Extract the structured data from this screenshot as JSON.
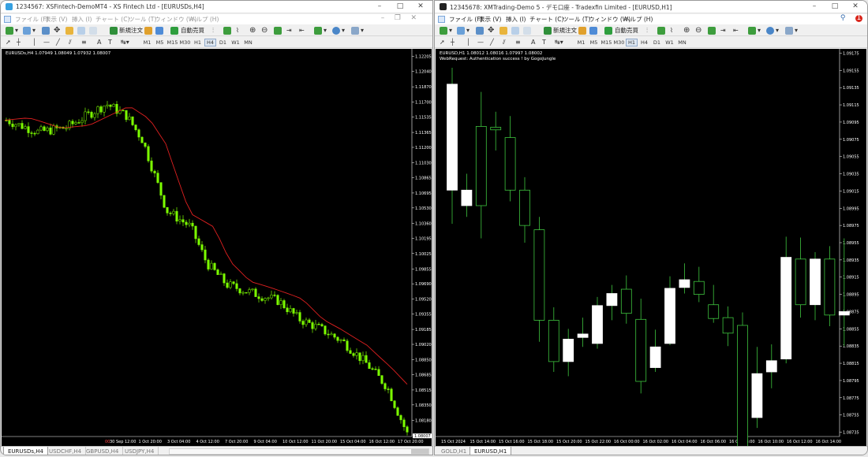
{
  "left": {
    "title": "1234567: XSFintech-DemoMT4 - XS Fintech Ltd - [EURUSDs,H4]",
    "menu": [
      "ファイル (F)",
      "表示 (V)",
      "挿入 (I)",
      "チャート (C)",
      "ツール (T)",
      "ウィンドウ (W)",
      "ヘルプ (H)"
    ],
    "toolbar": {
      "new_order": "新規注文",
      "auto_trade": "自動売買",
      "text_tool": "A"
    },
    "timeframes": [
      "M1",
      "M5",
      "M15",
      "M30",
      "H1",
      "H4",
      "D1",
      "W1",
      "MN"
    ],
    "selected_timeframe": "H4",
    "symbol_info": "EURUSDs,H4  1.07949 1.08049 1.07932 1.08007",
    "price_labels": [
      "1.12205",
      "1.12040",
      "1.11870",
      "1.11700",
      "1.11535",
      "1.11365",
      "1.11200",
      "1.11030",
      "1.10865",
      "1.10695",
      "1.10530",
      "1.10360",
      "1.10195",
      "1.10025",
      "1.09855",
      "1.09690",
      "1.09520",
      "1.09355",
      "1.09185",
      "1.09020",
      "1.08850",
      "1.08685",
      "1.08515",
      "1.08350",
      "1.08180"
    ],
    "current_price": "1.08007",
    "time_labels": [
      "00",
      "30 Sep 12:00",
      "1 Oct 20:00",
      "3 Oct 04:00",
      "4 Oct 12:00",
      "7 Oct 20:00",
      "9 Oct 04:00",
      "10 Oct 12:00",
      "11 Oct 20:00",
      "15 Oct 04:00",
      "16 Oct 12:00",
      "17 Oct 20:00"
    ],
    "tabs": [
      "EURUSDs,H4",
      "USDCHF,H4",
      "GBPUSD,H4",
      "USDJPY,H4"
    ],
    "active_tab": "EURUSDs,H4",
    "colors": {
      "candle": "#7CFC00",
      "ma": "#e02020"
    }
  },
  "right": {
    "title": "12345678: XMTrading-Demo 5 - デモ口座 - Tradexfin Limited - [EURUSD,H1]",
    "menu": [
      "ファイル (F)",
      "表示 (V)",
      "挿入 (I)",
      "チャート (C)",
      "ツール (T)",
      "ウィンドウ (W)",
      "ヘルプ (H)"
    ],
    "toolbar": {
      "new_order": "新規注文",
      "auto_trade": "自動売買",
      "text_tool": "A"
    },
    "timeframes": [
      "M1",
      "M5",
      "M15",
      "M30",
      "H1",
      "H4",
      "D1",
      "W1",
      "MN"
    ],
    "selected_timeframe": "H1",
    "symbol_info": "EURUSD,H1  1.08012 1.08016 1.07997 1.08002",
    "sub_info": "WebRequest: Authentication success ! by GogoJungle",
    "price_labels": [
      "1.09175",
      "1.09155",
      "1.09135",
      "1.09115",
      "1.09095",
      "1.09075",
      "1.09055",
      "1.09035",
      "1.09015",
      "1.08995",
      "1.08975",
      "1.08955",
      "1.08935",
      "1.08915",
      "1.08895",
      "1.08875",
      "1.08855",
      "1.08835",
      "1.08815",
      "1.08795",
      "1.08775",
      "1.08755",
      "1.08735"
    ],
    "time_labels": [
      "15 Oct 2024",
      "15 Oct 14:00",
      "15 Oct 16:00",
      "15 Oct 18:00",
      "15 Oct 20:00",
      "15 Oct 22:00",
      "16 Oct 00:00",
      "16 Oct 02:00",
      "16 Oct 04:00",
      "16 Oct 06:00",
      "16 Oct 08:00",
      "16 Oct 10:00",
      "16 Oct 12:00",
      "16 Oct 14:00"
    ],
    "tabs": [
      "GOLD,H1",
      "EURUSD,H1"
    ],
    "active_tab": "EURUSD,H1",
    "colors": {
      "bull_body": "#ffffff",
      "bear_body": "#000000",
      "wick": "#3ec43e"
    }
  },
  "chart_data": [
    {
      "type": "candlestick",
      "title": "EURUSDs,H4",
      "ylim": [
        1.08,
        1.1229
      ],
      "yticks": [
        1.12205,
        1.1204,
        1.1187,
        1.117,
        1.11535,
        1.11365,
        1.112,
        1.1103,
        1.10865,
        1.10695,
        1.1053,
        1.1036,
        1.10195,
        1.10025,
        1.09855,
        1.0969,
        1.0952,
        1.09355,
        1.09185,
        1.0902,
        1.0885,
        1.08685,
        1.08515,
        1.0835,
        1.0818
      ],
      "trend_anchors": [
        [
          0,
          1.115
        ],
        [
          0.08,
          1.1137
        ],
        [
          0.15,
          1.1142
        ],
        [
          0.25,
          1.1168
        ],
        [
          0.3,
          1.1155
        ],
        [
          0.34,
          1.1128
        ],
        [
          0.4,
          1.105
        ],
        [
          0.46,
          1.1032
        ],
        [
          0.5,
          1.0992
        ],
        [
          0.55,
          1.0968
        ],
        [
          0.62,
          1.0958
        ],
        [
          0.68,
          1.095
        ],
        [
          0.73,
          1.093
        ],
        [
          0.78,
          1.092
        ],
        [
          0.84,
          1.0905
        ],
        [
          0.9,
          1.088
        ],
        [
          0.95,
          1.0855
        ],
        [
          1.0,
          1.0803
        ]
      ],
      "moving_average": {
        "start": 1.1145,
        "end": 1.0838
      }
    },
    {
      "type": "candlestick",
      "title": "EURUSD,H1",
      "ylim": [
        1.0873,
        1.0918
      ],
      "yticks": [
        1.09175,
        1.09155,
        1.09135,
        1.09115,
        1.09095,
        1.09075,
        1.09055,
        1.09035,
        1.09015,
        1.08995,
        1.08975,
        1.08955,
        1.08935,
        1.08915,
        1.08895,
        1.08875,
        1.08855,
        1.08835,
        1.08815,
        1.08795,
        1.08775,
        1.08755,
        1.08735
      ],
      "candles": [
        {
          "o": 1.09016,
          "c": 1.09139,
          "h": 1.09158,
          "l": 1.08977
        },
        {
          "o": 1.08998,
          "c": 1.09016,
          "h": 1.09035,
          "l": 1.08985
        },
        {
          "o": 1.0909,
          "c": 1.08998,
          "h": 1.0913,
          "l": 1.0896
        },
        {
          "o": 1.09089,
          "c": 1.09086,
          "h": 1.09107,
          "l": 1.09062
        },
        {
          "o": 1.09077,
          "c": 1.09016,
          "h": 1.09102,
          "l": 1.09003
        },
        {
          "o": 1.09016,
          "c": 1.08975,
          "h": 1.09031,
          "l": 1.08955
        },
        {
          "o": 1.0897,
          "c": 1.08865,
          "h": 1.08985,
          "l": 1.0884
        },
        {
          "o": 1.08865,
          "c": 1.08817,
          "h": 1.0888,
          "l": 1.08805
        },
        {
          "o": 1.08817,
          "c": 1.08843,
          "h": 1.08855,
          "l": 1.088
        },
        {
          "o": 1.08845,
          "c": 1.08849,
          "h": 1.08868,
          "l": 1.08834
        },
        {
          "o": 1.08838,
          "c": 1.08882,
          "h": 1.08892,
          "l": 1.08832
        },
        {
          "o": 1.08882,
          "c": 1.08896,
          "h": 1.08906,
          "l": 1.08865
        },
        {
          "o": 1.08901,
          "c": 1.08873,
          "h": 1.08917,
          "l": 1.08861
        },
        {
          "o": 1.08866,
          "c": 1.08794,
          "h": 1.0889,
          "l": 1.0878
        },
        {
          "o": 1.0881,
          "c": 1.08834,
          "h": 1.08854,
          "l": 1.08805
        },
        {
          "o": 1.08838,
          "c": 1.08902,
          "h": 1.08916,
          "l": 1.08836
        },
        {
          "o": 1.08903,
          "c": 1.08912,
          "h": 1.08931,
          "l": 1.08896
        },
        {
          "o": 1.0891,
          "c": 1.08895,
          "h": 1.08927,
          "l": 1.08886
        },
        {
          "o": 1.08883,
          "c": 1.08867,
          "h": 1.08906,
          "l": 1.08862
        },
        {
          "o": 1.08868,
          "c": 1.0885,
          "h": 1.08881,
          "l": 1.08835
        },
        {
          "o": 1.08859,
          "c": 1.08717,
          "h": 1.08874,
          "l": 1.08705
        },
        {
          "o": 1.08752,
          "c": 1.08803,
          "h": 1.08834,
          "l": 1.0874
        },
        {
          "o": 1.08805,
          "c": 1.08818,
          "h": 1.08837,
          "l": 1.08786
        },
        {
          "o": 1.0882,
          "c": 1.08938,
          "h": 1.08962,
          "l": 1.08815
        },
        {
          "o": 1.08936,
          "c": 1.08883,
          "h": 1.08961,
          "l": 1.08868
        },
        {
          "o": 1.08883,
          "c": 1.08936,
          "h": 1.08944,
          "l": 1.08865
        },
        {
          "o": 1.08936,
          "c": 1.08871,
          "h": 1.08951,
          "l": 1.08858
        },
        {
          "o": 1.08871,
          "c": 1.08875,
          "h": 1.0896,
          "l": 1.08835
        }
      ]
    }
  ]
}
